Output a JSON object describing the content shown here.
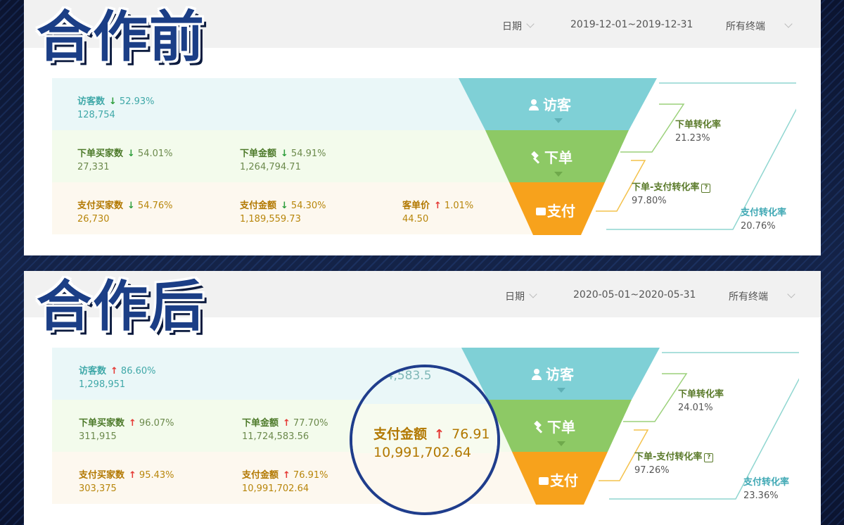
{
  "before": {
    "title": "合作前",
    "date_label": "日期",
    "date_range": "2019-12-01~2019-12-31",
    "terminal": "所有终端",
    "visitors": {
      "label": "访客数",
      "pct": "52.93%",
      "value": "128,754",
      "trend": "down"
    },
    "order_buyers": {
      "label": "下单买家数",
      "pct": "54.01%",
      "value": "27,331",
      "trend": "down"
    },
    "order_amount": {
      "label": "下单金额",
      "pct": "54.91%",
      "value": "1,264,794.71",
      "trend": "down"
    },
    "pay_buyers": {
      "label": "支付买家数",
      "pct": "54.76%",
      "value": "26,730",
      "trend": "down"
    },
    "pay_amount": {
      "label": "支付金额",
      "pct": "54.30%",
      "value": "1,189,559.73",
      "trend": "down"
    },
    "unit_price": {
      "label": "客单价",
      "pct": "1.01%",
      "value": "44.50",
      "trend": "up"
    },
    "order_rate": {
      "label": "下单转化率",
      "value": "21.23%"
    },
    "order_pay_rate": {
      "label": "下单-支付转化率",
      "value": "97.80%"
    },
    "pay_rate": {
      "label": "支付转化率",
      "value": "20.76%"
    }
  },
  "after": {
    "title": "合作后",
    "date_label": "日期",
    "date_range": "2020-05-01~2020-05-31",
    "terminal": "所有终端",
    "visitors": {
      "label": "访客数",
      "pct": "86.60%",
      "value": "1,298,951",
      "trend": "up"
    },
    "order_buyers": {
      "label": "下单买家数",
      "pct": "96.07%",
      "value": "311,915",
      "trend": "up"
    },
    "order_amount": {
      "label": "下单金额",
      "pct": "77.70%",
      "value": "11,724,583.56",
      "trend": "up"
    },
    "pay_buyers": {
      "label": "支付买家数",
      "pct": "95.43%",
      "value": "303,375",
      "trend": "up"
    },
    "pay_amount": {
      "label": "支付金额",
      "pct": "76.91%",
      "value": "10,991,702.64",
      "trend": "up"
    },
    "order_rate": {
      "label": "下单转化率",
      "value": "24.01%"
    },
    "order_pay_rate": {
      "label": "下单-支付转化率",
      "value": "97.26%"
    },
    "pay_rate": {
      "label": "支付转化率",
      "value": "23.36%"
    },
    "zoom": {
      "faint": "724,583.5",
      "label": "支付金额",
      "pct": "76.91",
      "value": "10,991,702.64"
    }
  },
  "funnel": {
    "visitor": "访客",
    "order": "下单",
    "pay": "支付"
  },
  "arrows": {
    "down": "↓",
    "up": "↑"
  },
  "colors": {
    "teal": "#7fd0d6",
    "green": "#8dc965",
    "orange": "#f7a21c",
    "title_blue": "#1b3e86"
  }
}
